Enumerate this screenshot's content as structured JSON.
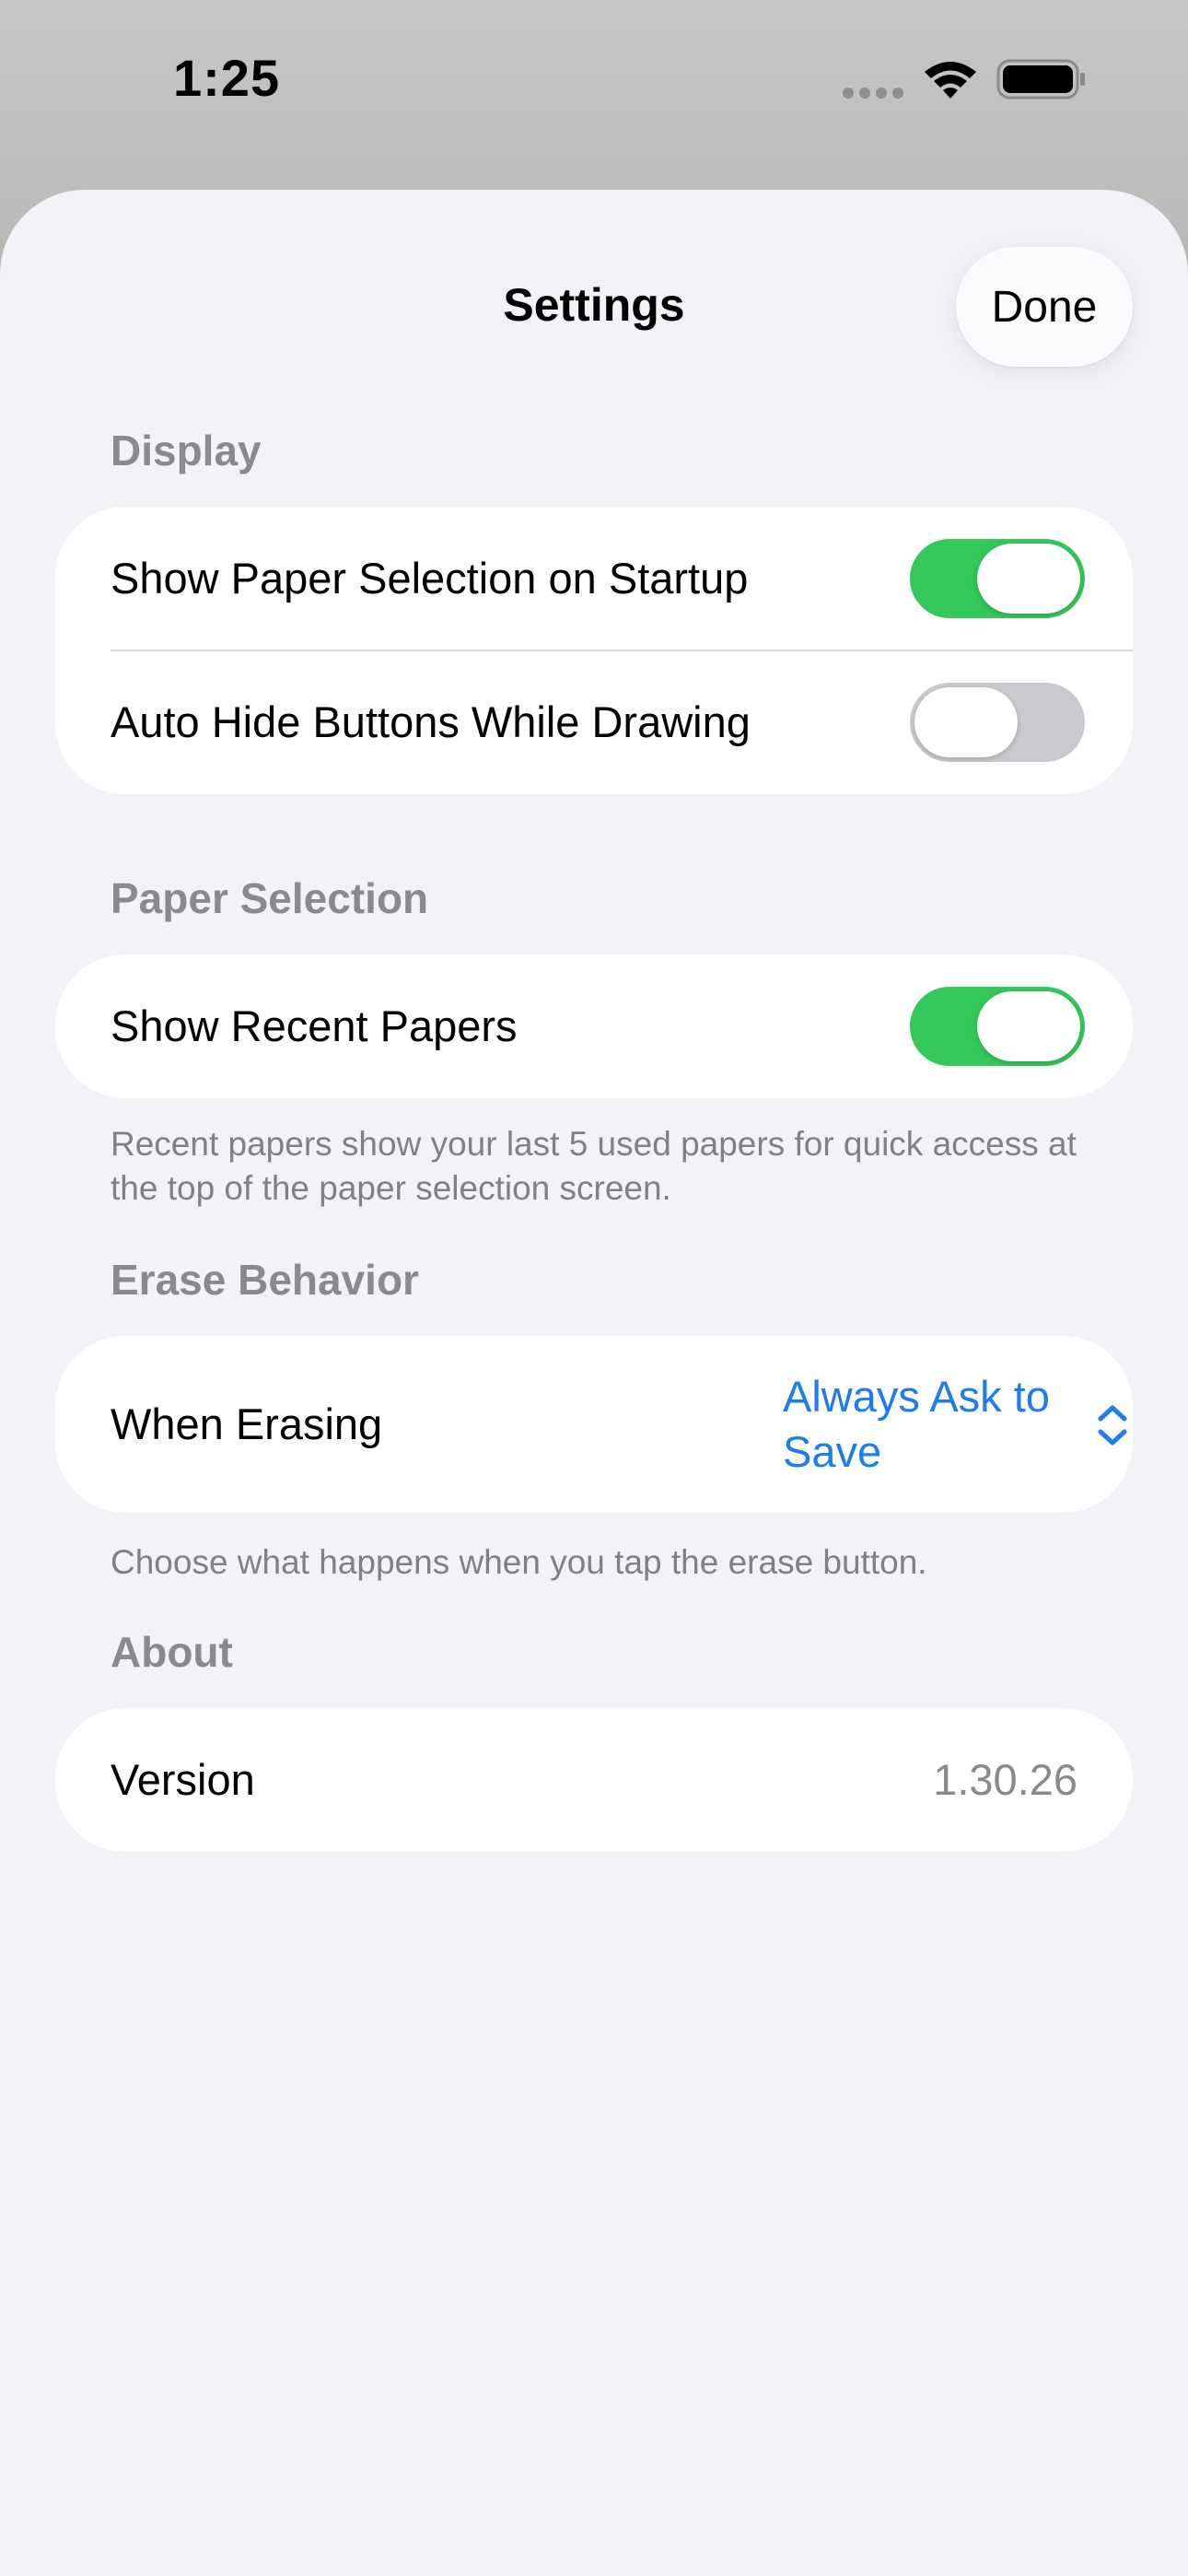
{
  "status_bar": {
    "time": "1:25",
    "icons": [
      "cellular-signal-icon",
      "wifi-icon",
      "battery-icon"
    ]
  },
  "nav": {
    "title": "Settings",
    "done_label": "Done"
  },
  "sections": {
    "display": {
      "header": "Display",
      "rows": [
        {
          "label": "Show Paper Selection on Startup",
          "toggle_on": true
        },
        {
          "label": "Auto Hide Buttons While Drawing",
          "toggle_on": false
        }
      ]
    },
    "paper_selection": {
      "header": "Paper Selection",
      "rows": [
        {
          "label": "Show Recent Papers",
          "toggle_on": true
        }
      ],
      "footer": "Recent papers show your last 5 used papers for quick access at the top of the paper selection screen."
    },
    "erase_behavior": {
      "header": "Erase Behavior",
      "row": {
        "label": "When Erasing",
        "value": "Always Ask to Save"
      },
      "footer": "Choose what happens when you tap the erase button."
    },
    "about": {
      "header": "About",
      "row": {
        "label": "Version",
        "value": "1.30.26"
      }
    }
  },
  "colors": {
    "toggle_on": "#34c759",
    "toggle_off": "#c9c9ce",
    "accent": "#1e7cf2",
    "background": "#f2f2f7",
    "secondary_text": "#8a8a8e"
  }
}
